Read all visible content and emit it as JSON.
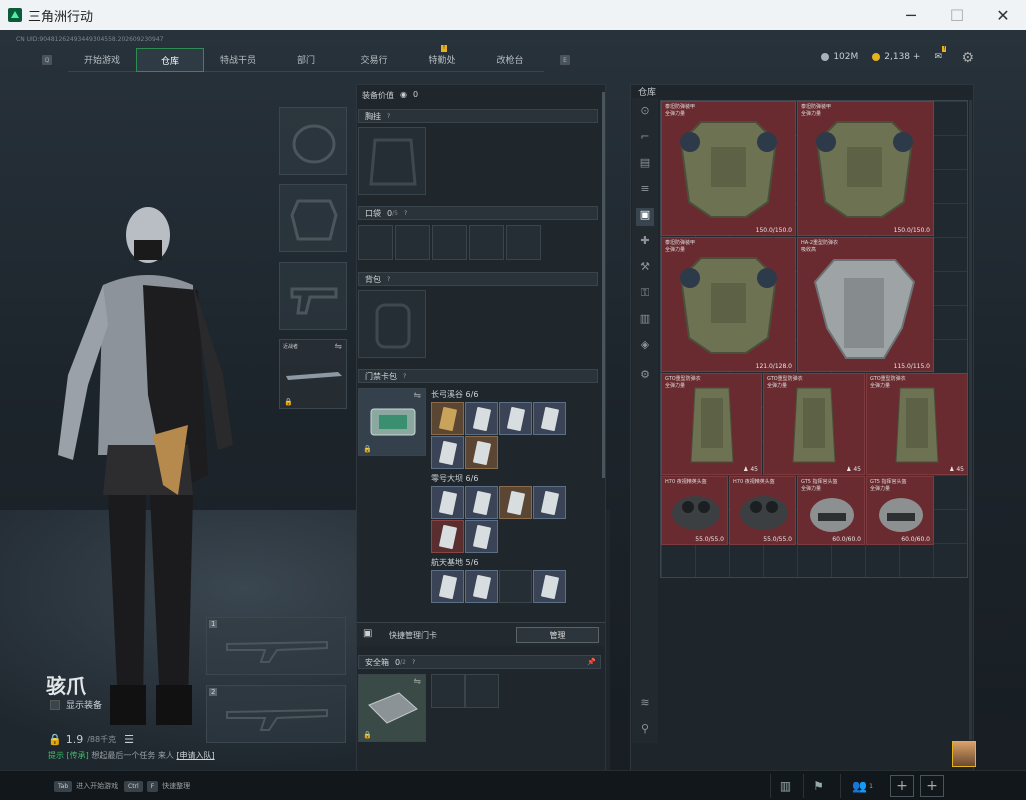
{
  "window": {
    "title": "三角洲行动",
    "min": "─",
    "max": "☐",
    "close": "✕"
  },
  "uid": "CN UID:90481262493449304558.202609230947",
  "nav": {
    "left_key": "Q",
    "right_key": "E",
    "tabs": [
      "开始游戏",
      "仓库",
      "特战干员",
      "部门",
      "交易行",
      "特勤处",
      "改枪台"
    ],
    "badge": "!"
  },
  "currency": {
    "hafu": "102M",
    "coins": "2,138",
    "plus": "+",
    "mail_badge": "!"
  },
  "character": {
    "name": "骇爪",
    "show_equip": "显示装备",
    "weight": "1.9",
    "weight_max": "/88千克",
    "hint_prefix": "提示",
    "hint_tag": "[传承]",
    "hint_text": "想起最后一个任务 来人",
    "hint_link": "[申请入队]"
  },
  "loadout": {
    "melee_label": "近战者",
    "slot1": "1",
    "slot2": "2"
  },
  "equip": {
    "value_label": "装备价值",
    "value": "0",
    "chest": "胸挂",
    "pockets": "口袋",
    "pockets_count": "0",
    "pockets_max": "/5",
    "backpack": "背包",
    "keycard": "门禁卡包",
    "groups": [
      {
        "name": "长弓溪谷",
        "count": "6/6"
      },
      {
        "name": "零号大坝",
        "count": "6/6"
      },
      {
        "name": "航天基地",
        "count": "5/6"
      }
    ],
    "quick_manage": "快捷管理门卡",
    "manage_btn": "管理",
    "safe": "安全箱",
    "safe_count": "0",
    "safe_max": "/2"
  },
  "warehouse": {
    "label": "仓库",
    "items": [
      {
        "name": "泰坦防弹装甲",
        "sub": "全弹力量",
        "val": "150.0/150.0"
      },
      {
        "name": "泰坦防弹装甲",
        "sub": "全弹力量",
        "val": "150.0/150.0"
      },
      {
        "name": "泰坦防弹装甲",
        "sub": "全弹力量",
        "val": "121.0/128.0"
      },
      {
        "name": "HA-2重型防弹衣",
        "sub": "吸收高",
        "val": "115.0/115.0"
      },
      {
        "name": "GTO重型防弹衣",
        "sub": "全弹力量",
        "val": "45"
      },
      {
        "name": "GTO重型防弹衣",
        "sub": "全弹力量",
        "val": "45"
      },
      {
        "name": "GTO重型防弹衣",
        "sub": "全弹力量",
        "val": "45"
      },
      {
        "name": "H70 夜视精英头盔",
        "sub": "",
        "val": "55.0/55.0"
      },
      {
        "name": "H70 夜视精英头盔",
        "sub": "",
        "val": "55.0/55.0"
      },
      {
        "name": "GT5 指挥官头盔",
        "sub": "全弹力量",
        "val": "60.0/60.0"
      },
      {
        "name": "GT5 指挥官头盔",
        "sub": "全弹力量",
        "val": "60.0/60.0"
      }
    ]
  },
  "bottom": {
    "tab_key": "Tab",
    "tab_text": "进入开始游戏",
    "ctrl_key": "Ctrl",
    "f_key": "F",
    "ctrl_text": "快速整理",
    "squad": "1"
  },
  "colors": {
    "accent": "#2f8c52",
    "item_bg": "#6a2b30",
    "gold": "#e6b21e"
  }
}
